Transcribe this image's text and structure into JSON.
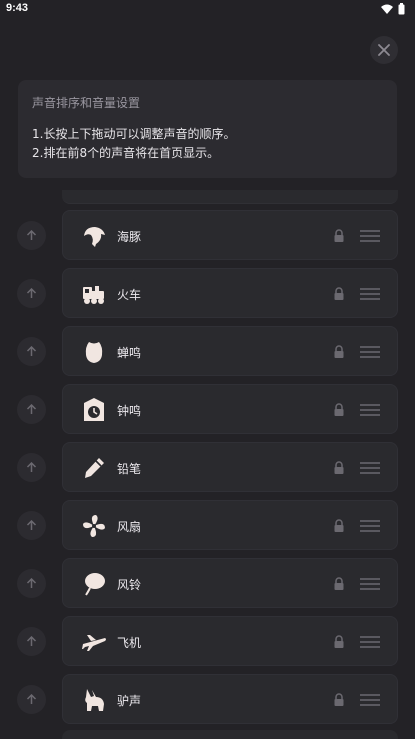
{
  "status_bar": {
    "time": "9:43"
  },
  "info_card": {
    "title": "声音排序和音量设置",
    "lines": [
      "1.长按上下拖动可以调整声音的顺序。",
      "2.排在前8个的声音将在首页显示。"
    ]
  },
  "sounds": [
    {
      "name": "海豚",
      "icon": "dolphin-icon"
    },
    {
      "name": "火车",
      "icon": "train-icon"
    },
    {
      "name": "蝉鸣",
      "icon": "cicada-icon"
    },
    {
      "name": "钟鸣",
      "icon": "clock-icon"
    },
    {
      "name": "铅笔",
      "icon": "pencil-icon"
    },
    {
      "name": "风扇",
      "icon": "fan-icon"
    },
    {
      "name": "风铃",
      "icon": "wind-chime-icon"
    },
    {
      "name": "飞机",
      "icon": "airplane-icon"
    },
    {
      "name": "驴声",
      "icon": "donkey-icon"
    }
  ],
  "colors": {
    "background": "#232226",
    "card": "#2a2a2e",
    "icon": "#f1e6e1",
    "muted": "#6b6970"
  }
}
